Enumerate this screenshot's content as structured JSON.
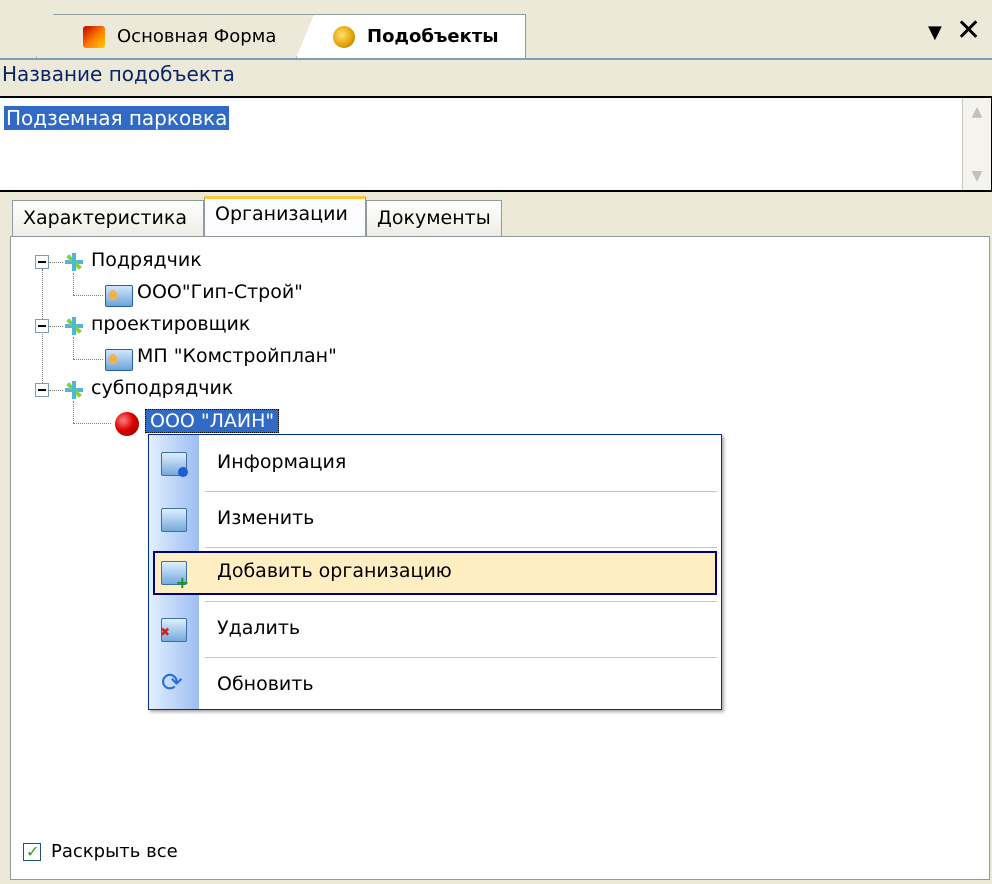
{
  "doc_tabs": [
    {
      "label": "Основная Форма",
      "icon": "main-form-icon"
    },
    {
      "label": "Подобъекты",
      "icon": "subobjects-icon"
    }
  ],
  "window_controls": {
    "pin": "▼",
    "close": "✕"
  },
  "name_field": {
    "label": "Название подобъекта",
    "value": "Подземная парковка"
  },
  "inner_tabs": [
    {
      "label": "Характеристика"
    },
    {
      "label": "Организации",
      "active": true
    },
    {
      "label": "Документы"
    }
  ],
  "tree": {
    "groups": [
      {
        "label": "Подрядчик",
        "children": [
          "ООО\"Гип-Строй\""
        ]
      },
      {
        "label": "проектировщик",
        "children": [
          "МП \"Комстройплан\""
        ]
      },
      {
        "label": "субподрядчик",
        "children": [
          "ООО \"ЛАИН\""
        ]
      }
    ],
    "selected": "ООО \"ЛАИН\""
  },
  "context_menu": {
    "items": [
      {
        "label": "Информация",
        "icon": "info-icon"
      },
      {
        "label": "Изменить",
        "icon": "edit-icon"
      },
      {
        "label": "Добавить организацию",
        "icon": "add-icon",
        "highlighted": true
      },
      {
        "label": "Удалить",
        "icon": "delete-icon"
      },
      {
        "label": "Обновить",
        "icon": "refresh-icon"
      }
    ]
  },
  "expand_all": {
    "label": "Раскрыть все",
    "checked": true
  },
  "colors": {
    "selection": "#316ac5",
    "menu_highlight": "#ffeec2",
    "label_blue": "#0a246a"
  }
}
